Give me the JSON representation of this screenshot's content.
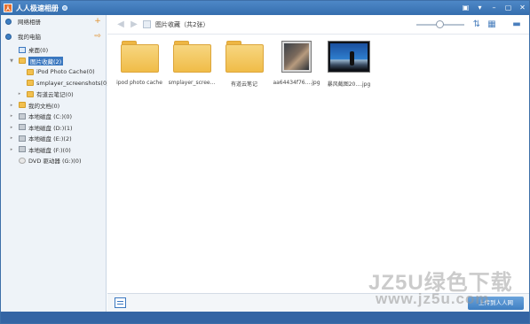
{
  "app": {
    "title": "人人极速相册",
    "logo_text": "人"
  },
  "window_buttons": [
    "▣",
    "▾",
    "–",
    "▢",
    "✕"
  ],
  "sidebar": {
    "network_section": {
      "label": "网络相册",
      "action": "+"
    },
    "local_section": {
      "label": "我的电脑",
      "action": "⇨"
    },
    "tree": [
      {
        "label": "桌面(0)"
      },
      {
        "label": "图片收藏(2)"
      },
      {
        "label": "iPod Photo Cache(0)"
      },
      {
        "label": "smplayer_screenshots(0)"
      },
      {
        "label": "有道云笔记(0)"
      },
      {
        "label": "我的文档(0)"
      },
      {
        "label": "本地磁盘 (C:)(0)"
      },
      {
        "label": "本地磁盘 (D:)(1)"
      },
      {
        "label": "本地磁盘 (E:)(2)"
      },
      {
        "label": "本地磁盘 (F:)(0)"
      },
      {
        "label": "DVD 驱动器 (G:)(0)"
      }
    ]
  },
  "toolbar": {
    "back_icon": "◀",
    "forward_icon": "▶",
    "breadcrumb": "图片收藏（共2张）",
    "sort_icon": "⇅",
    "view_icon": "▦",
    "briefcase_icon": "▬"
  },
  "items": [
    {
      "name": "ipod photo cache",
      "type": "folder"
    },
    {
      "name": "smplayer_scree...",
      "type": "folder"
    },
    {
      "name": "有道云笔记",
      "type": "folder"
    },
    {
      "name": "aa64434f76....jpg",
      "type": "photo"
    },
    {
      "name": "暴风截图20....jpg",
      "type": "photo"
    }
  ],
  "bottom": {
    "upload_label": "上传到人人网"
  },
  "watermark": {
    "line1": "JZ5U绿色下载",
    "line2": "www.jz5u.com"
  },
  "colors": {
    "accent": "#3b78c0",
    "title_bar": "#4e88c7",
    "folder": "#f2c04f"
  }
}
